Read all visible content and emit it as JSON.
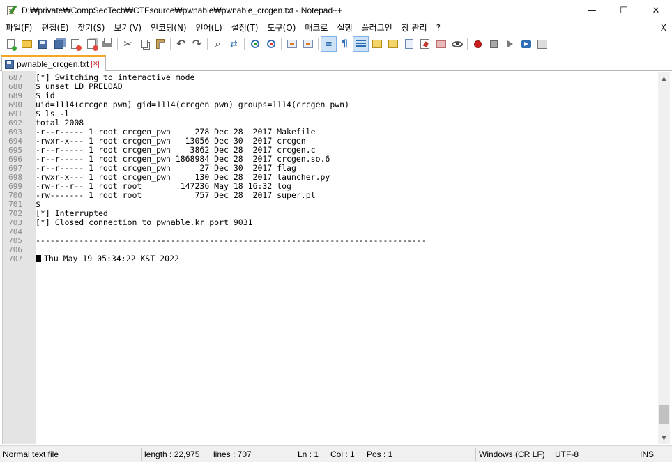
{
  "window": {
    "title": "D:₩private₩CompSecTech₩CTFsource₩pwnable₩pwnable_crcgen.txt - Notepad++",
    "controls": {
      "minimize": "—",
      "maximize": "☐",
      "close": "✕"
    }
  },
  "menu": {
    "items": [
      "파일(F)",
      "편집(E)",
      "찾기(S)",
      "보기(V)",
      "인코딩(N)",
      "언어(L)",
      "설정(T)",
      "도구(O)",
      "매크로",
      "실행",
      "플러그인",
      "창 관리",
      "?"
    ],
    "close_label": "X"
  },
  "toolbar": {
    "icons": [
      "new-file-icon",
      "open-file-icon",
      "save-icon",
      "save-all-icon",
      "close-icon",
      "close-all-icon",
      "print-icon",
      "cut-icon",
      "copy-icon",
      "paste-icon",
      "undo-icon",
      "redo-icon",
      "find-icon",
      "replace-icon",
      "zoom-in-icon",
      "zoom-out-icon",
      "sync-vertical-icon",
      "sync-horizontal-icon",
      "word-wrap-icon",
      "show-all-characters-icon",
      "indent-guide-icon",
      "user-language-icon",
      "document-map-icon",
      "function-list-icon",
      "folder-as-workspace-icon",
      "monitoring-icon",
      "record-macro-icon",
      "stop-macro-icon",
      "playback-macro-icon",
      "run-macro-multiple-icon",
      "save-macro-icon"
    ]
  },
  "tabs": [
    {
      "label": "pwnable_crcgen.txt",
      "active": true,
      "close_glyph": "✕"
    }
  ],
  "editor": {
    "lines": [
      {
        "no": "687",
        "text": "[*] Switching to interactive mode"
      },
      {
        "no": "688",
        "text": "$ unset LD_PRELOAD"
      },
      {
        "no": "689",
        "text": "$ id"
      },
      {
        "no": "690",
        "text": "uid=1114(crcgen_pwn) gid=1114(crcgen_pwn) groups=1114(crcgen_pwn)"
      },
      {
        "no": "691",
        "text": "$ ls -l"
      },
      {
        "no": "692",
        "text": "total 2008"
      },
      {
        "no": "693",
        "text": "-r--r----- 1 root crcgen_pwn     278 Dec 28  2017 Makefile"
      },
      {
        "no": "694",
        "text": "-rwxr-x--- 1 root crcgen_pwn   13056 Dec 30  2017 crcgen"
      },
      {
        "no": "695",
        "text": "-r--r----- 1 root crcgen_pwn    3862 Dec 28  2017 crcgen.c"
      },
      {
        "no": "696",
        "text": "-r--r----- 1 root crcgen_pwn 1868984 Dec 28  2017 crcgen.so.6"
      },
      {
        "no": "697",
        "text": "-r--r----- 1 root crcgen_pwn      27 Dec 30  2017 flag"
      },
      {
        "no": "698",
        "text": "-rwxr-x--- 1 root crcgen_pwn     130 Dec 28  2017 launcher.py"
      },
      {
        "no": "699",
        "text": "-rw-r--r-- 1 root root        147236 May 18 16:32 log"
      },
      {
        "no": "700",
        "text": "-rw------- 1 root root           757 Dec 28  2017 super.pl"
      },
      {
        "no": "701",
        "text": "$"
      },
      {
        "no": "702",
        "text": "[*] Interrupted"
      },
      {
        "no": "703",
        "text": "[*] Closed connection to pwnable.kr port 9031"
      },
      {
        "no": "704",
        "text": ""
      },
      {
        "no": "705",
        "text": "---------------------------------------------------------------------------------"
      },
      {
        "no": "706",
        "text": ""
      },
      {
        "no": "707",
        "text": "Thu May 19 05:34:22 KST 2022",
        "block_marker": true
      }
    ]
  },
  "scrollbar": {
    "up_glyph": "▲",
    "down_glyph": "▼",
    "position_fraction": 0.97
  },
  "status": {
    "file_type": "Normal text file",
    "length": "length : 22,975",
    "lines": "lines : 707",
    "ln": "Ln : 1",
    "col": "Col : 1",
    "pos": "Pos : 1",
    "eol": "Windows (CR LF)",
    "encoding": "UTF-8",
    "mode": "INS"
  }
}
